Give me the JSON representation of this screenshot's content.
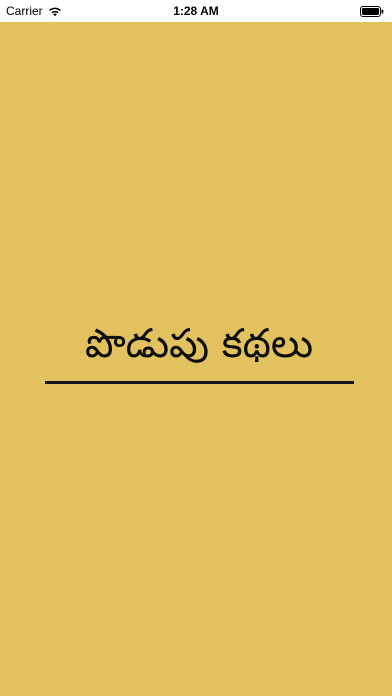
{
  "status_bar": {
    "carrier": "Carrier",
    "time": "1:28 AM",
    "icons": {
      "wifi": "wifi-icon",
      "battery": "battery-icon"
    }
  },
  "splash": {
    "title": "పొడుపు కథలు",
    "background_color": "#e1c25f",
    "text_color": "#0c0c0c"
  }
}
